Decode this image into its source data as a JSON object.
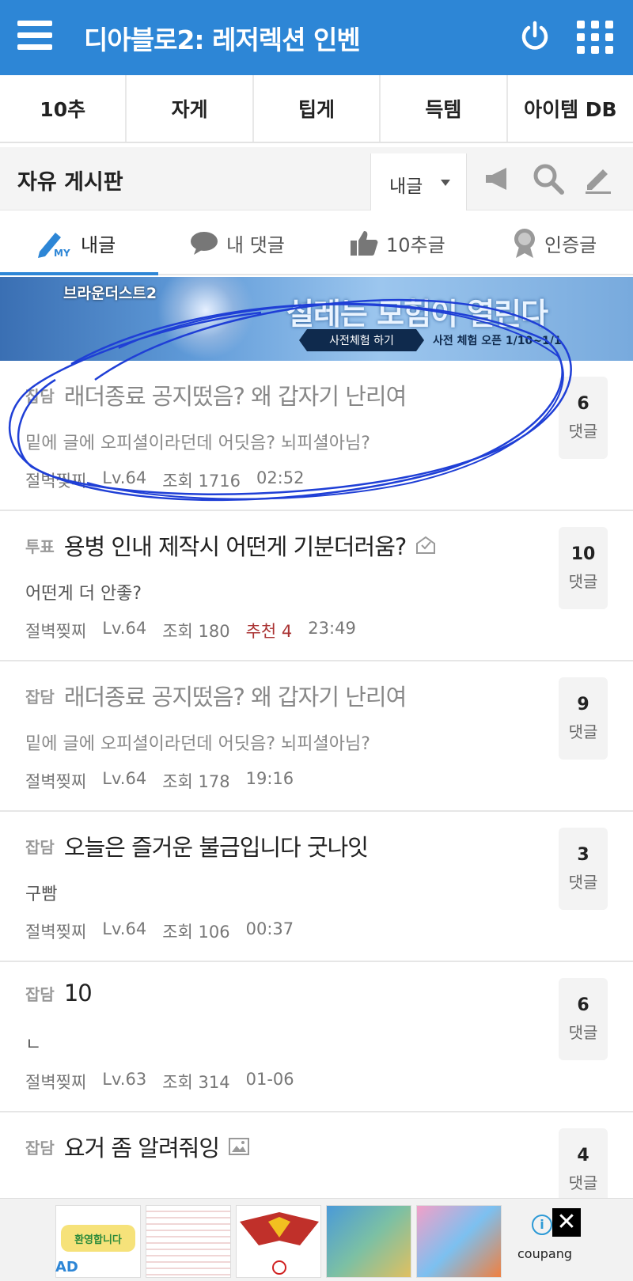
{
  "header": {
    "title": "디아블로2: 레저렉션 인벤",
    "accent_color": "#2d86d6",
    "icons": [
      "menu-icon",
      "power-icon",
      "apps-grid-icon"
    ]
  },
  "categories": [
    "10추",
    "자게",
    "팁게",
    "득템",
    "아이템 DB"
  ],
  "board": {
    "title": "자유 게시판",
    "filter_selected": "내글",
    "tool_icons": [
      "megaphone-icon",
      "search-icon",
      "write-icon"
    ]
  },
  "my_tabs": [
    {
      "label": "내글",
      "active": true,
      "icon": "my-pen-icon"
    },
    {
      "label": "내 댓글",
      "active": false,
      "icon": "speech-bubble-icon"
    },
    {
      "label": "10추글",
      "active": false,
      "icon": "thumbs-up-icon"
    },
    {
      "label": "인증글",
      "active": false,
      "icon": "badge-icon"
    }
  ],
  "banner": {
    "logo": "브라운더스트2",
    "slogan": "설레는 모험이 열린다",
    "button": "사전체험 하기",
    "date": "사전 체험 오픈 1/10~1/1"
  },
  "posts": [
    {
      "category": "잡담",
      "title": "래더종료 공지떴음? 왜 갑자기 난리여",
      "preview": "밑에 글에 오피셜이라던데 어딧음? 뇌피셜아님?",
      "author": "절벽찢찌",
      "level": "Lv.64",
      "views": "조회 1716",
      "recommend": "",
      "time": "02:52",
      "comments": "6",
      "comments_label": "댓글",
      "read": true,
      "icon": ""
    },
    {
      "category": "투표",
      "title": "용병 인내 제작시 어떤게 기분더러움?",
      "preview": "어떤게 더 안좋?",
      "author": "절벽찢찌",
      "level": "Lv.64",
      "views": "조회 180",
      "recommend": "추천 4",
      "time": "23:49",
      "comments": "10",
      "comments_label": "댓글",
      "read": false,
      "icon": "vote-icon"
    },
    {
      "category": "잡담",
      "title": "래더종료 공지떴음? 왜 갑자기 난리여",
      "preview": "밑에 글에 오피셜이라던데 어딧음? 뇌피셜아님?",
      "author": "절벽찢찌",
      "level": "Lv.64",
      "views": "조회 178",
      "recommend": "",
      "time": "19:16",
      "comments": "9",
      "comments_label": "댓글",
      "read": true,
      "icon": ""
    },
    {
      "category": "잡담",
      "title": "오늘은 즐거운 불금입니다 굿나잇",
      "preview": "구빰",
      "author": "절벽찢찌",
      "level": "Lv.64",
      "views": "조회 106",
      "recommend": "",
      "time": "00:37",
      "comments": "3",
      "comments_label": "댓글",
      "read": false,
      "icon": ""
    },
    {
      "category": "잡담",
      "title": "10",
      "preview": "ㄴ",
      "author": "절벽찢찌",
      "level": "Lv.63",
      "views": "조회 314",
      "recommend": "",
      "time": "01-06",
      "comments": "6",
      "comments_label": "댓글",
      "read": false,
      "icon": ""
    },
    {
      "category": "잡담",
      "title": "요거 좀 알려줘잉",
      "preview": "",
      "author": "",
      "level": "",
      "views": "",
      "recommend": "",
      "time": "",
      "comments": "4",
      "comments_label": "댓글",
      "read": false,
      "icon": "image-icon"
    }
  ],
  "ad": {
    "label": "AD",
    "brand": "coupang",
    "info": "i",
    "close": "✕",
    "thumb_text": "환영합니다"
  }
}
